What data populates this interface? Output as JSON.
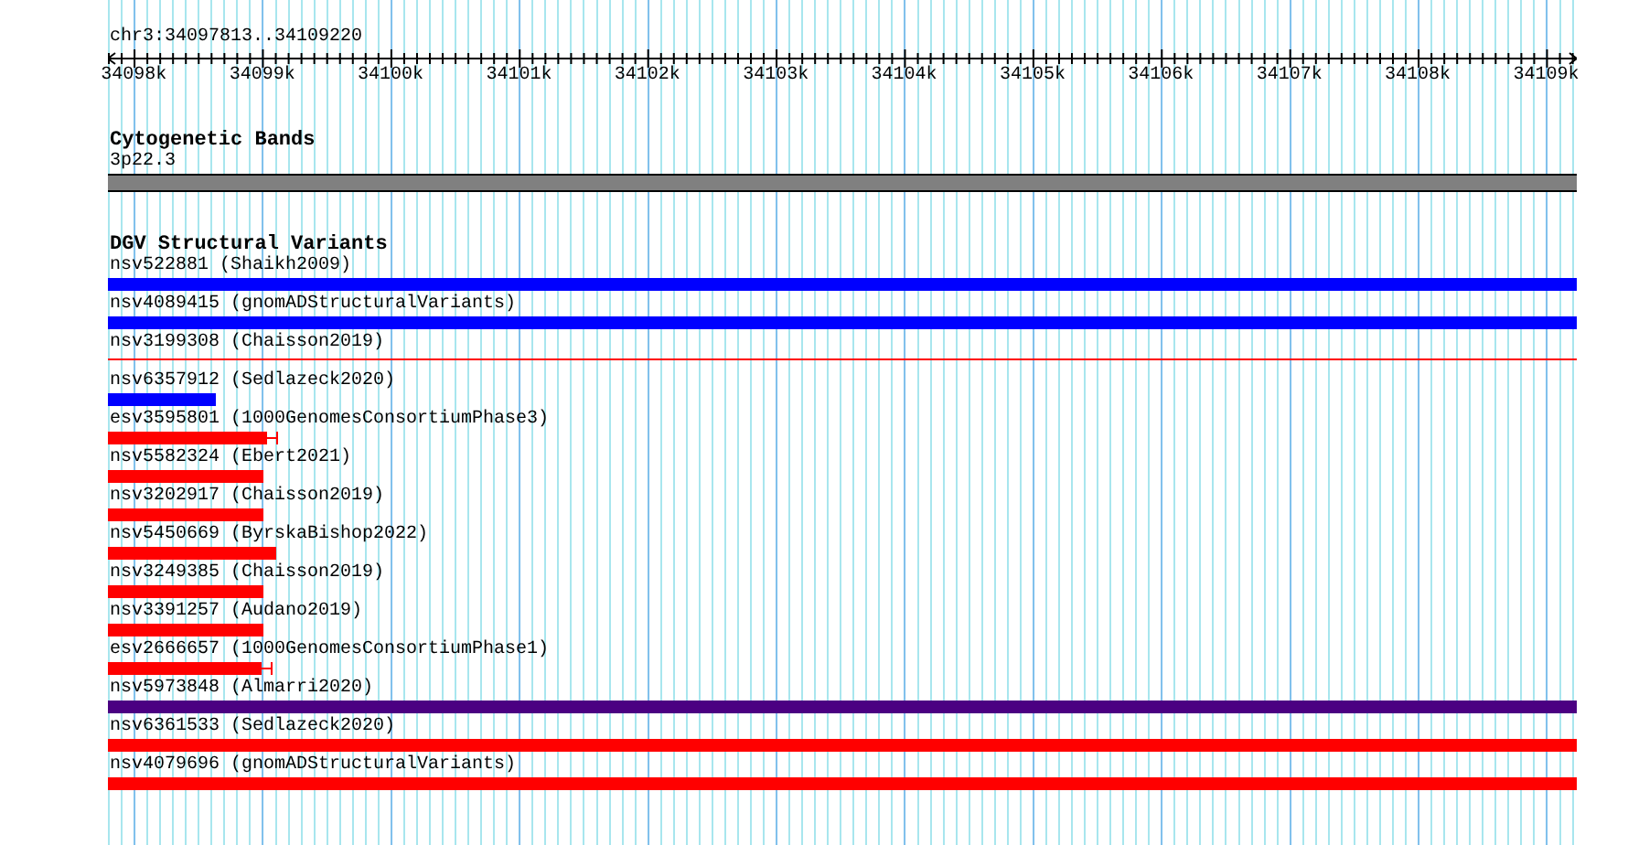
{
  "ruler": {
    "location": "chr3:34097813..34109220",
    "ticks": [
      "34098k",
      "34099k",
      "34100k",
      "34101k",
      "34102k",
      "34103k",
      "34104k",
      "34105k",
      "34106k",
      "34107k",
      "34108k",
      "34109k"
    ]
  },
  "tracks": [
    {
      "title": "Cytogenetic Bands",
      "features": [
        {
          "label": "3p22.3",
          "kind": "band",
          "color": "#808080",
          "level": 1
        }
      ]
    },
    {
      "title": "DGV Structural Variants",
      "features": [
        {
          "label": "nsv522881 (Shaikh2009)",
          "kind": "bar",
          "color": "#0000ff",
          "level": 1
        },
        {
          "label": "nsv4089415 (gnomADStructuralVariants)",
          "kind": "bar",
          "color": "#0000ff",
          "level": 1
        },
        {
          "label": "nsv3199308 (Chaisson2019)",
          "kind": "line",
          "color": "#ff0000",
          "level": 1
        },
        {
          "label": "nsv6357912 (Sedlazeck2020)",
          "kind": "bar",
          "color": "#0000ff",
          "level": 0.073
        },
        {
          "label": "esv3595801 (1000GenomesConsortiumPhase3)",
          "kind": "capped",
          "color": "#ff0000",
          "level": 0.116
        },
        {
          "label": "nsv5582324 (Ebert2021)",
          "kind": "bar",
          "color": "#ff0000",
          "level": 0.106
        },
        {
          "label": "nsv3202917 (Chaisson2019)",
          "kind": "bar",
          "color": "#ff0000",
          "level": 0.106
        },
        {
          "label": "nsv5450669 (ByrskaBishop2022)",
          "kind": "bar",
          "color": "#ff0000",
          "level": 0.114
        },
        {
          "label": "nsv3249385 (Chaisson2019)",
          "kind": "bar",
          "color": "#ff0000",
          "level": 0.106
        },
        {
          "label": "nsv3391257 (Audano2019)",
          "kind": "bar",
          "color": "#ff0000",
          "level": 0.106
        },
        {
          "label": "esv2666657 (1000GenomesConsortiumPhase1)",
          "kind": "capped",
          "color": "#ff0000",
          "level": 0.112
        },
        {
          "label": "nsv5973848 (Almarri2020)",
          "kind": "bar",
          "color": "#4b0082",
          "level": 1
        },
        {
          "label": "nsv6361533 (Sedlazeck2020)",
          "kind": "bar",
          "color": "#ff0000",
          "level": 1
        },
        {
          "label": "nsv4079696 (gnomADStructuralVariants)",
          "kind": "bar",
          "color": "#ff0000",
          "level": 1
        }
      ]
    }
  ]
}
